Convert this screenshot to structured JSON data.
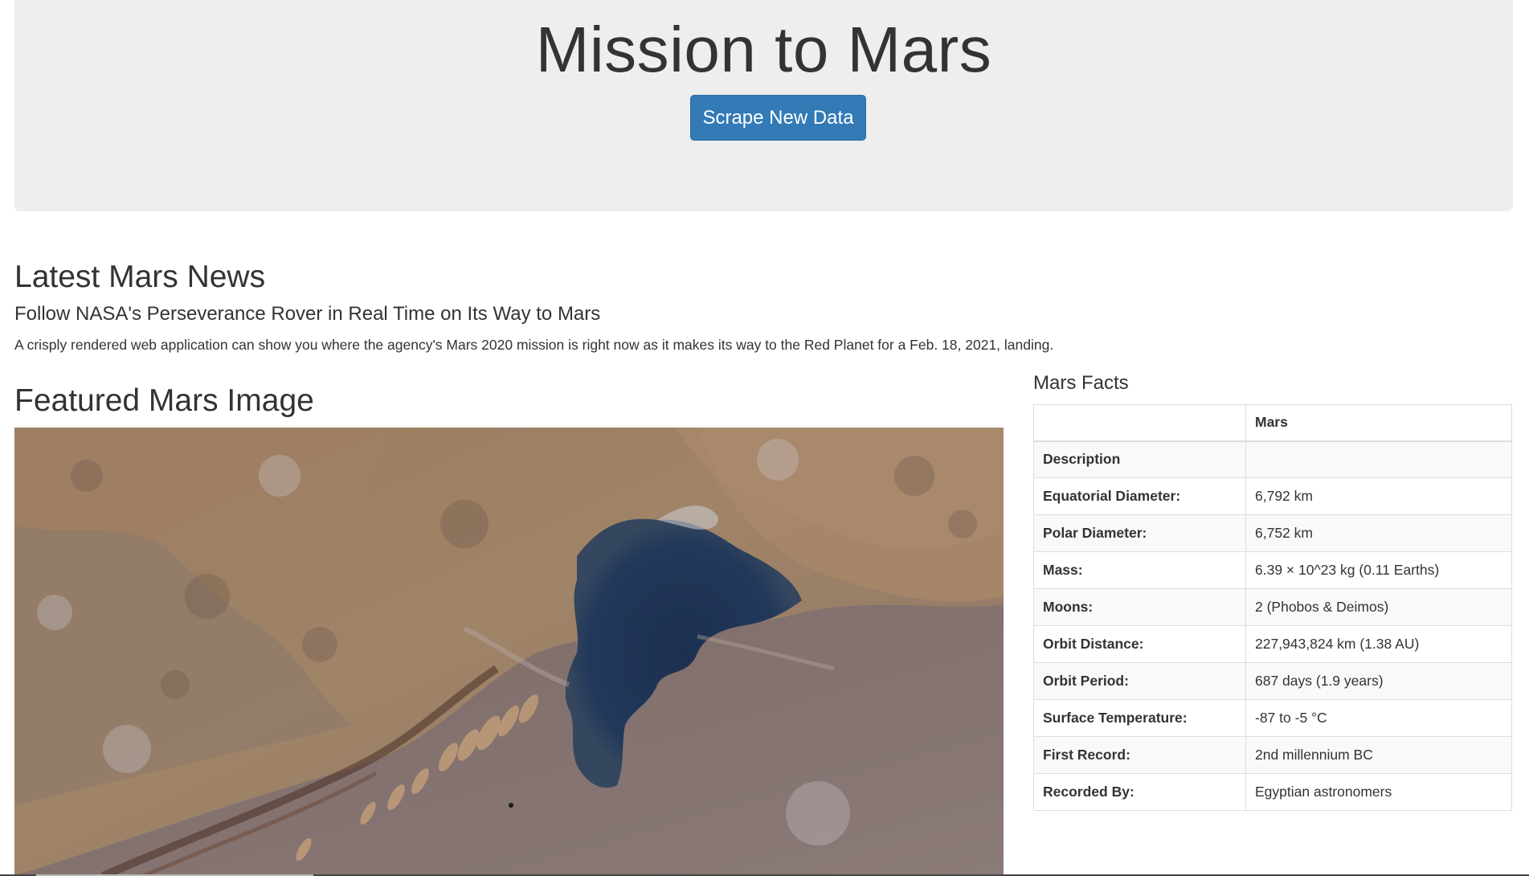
{
  "header": {
    "title": "Mission to Mars",
    "scrape_button_label": "Scrape New Data"
  },
  "news": {
    "section_heading": "Latest Mars News",
    "title": "Follow NASA's Perseverance Rover in Real Time on Its Way to Mars",
    "paragraph": "A crisply rendered web application can show you where the agency's Mars 2020 mission is right now as it makes its way to the Red Planet for a Feb. 18, 2021, landing."
  },
  "featured": {
    "section_heading": "Featured Mars Image"
  },
  "facts": {
    "section_heading": "Mars Facts",
    "columns": [
      "",
      "Mars"
    ],
    "rows": [
      {
        "label": "Description",
        "value": ""
      },
      {
        "label": "Equatorial Diameter:",
        "value": "6,792 km"
      },
      {
        "label": "Polar Diameter:",
        "value": "6,752 km"
      },
      {
        "label": "Mass:",
        "value": "6.39 × 10^23 kg (0.11 Earths)"
      },
      {
        "label": "Moons:",
        "value": "2 (Phobos & Deimos)"
      },
      {
        "label": "Orbit Distance:",
        "value": "227,943,824 km (1.38 AU)"
      },
      {
        "label": "Orbit Period:",
        "value": "687 days (1.9 years)"
      },
      {
        "label": "Surface Temperature:",
        "value": "-87 to -5 °C"
      },
      {
        "label": "First Record:",
        "value": "2nd millennium BC"
      },
      {
        "label": "Recorded By:",
        "value": "Egyptian astronomers"
      }
    ]
  },
  "colors": {
    "primary_button": "#337ab7",
    "jumbotron_bg": "#eeeeee",
    "text": "#333333"
  }
}
